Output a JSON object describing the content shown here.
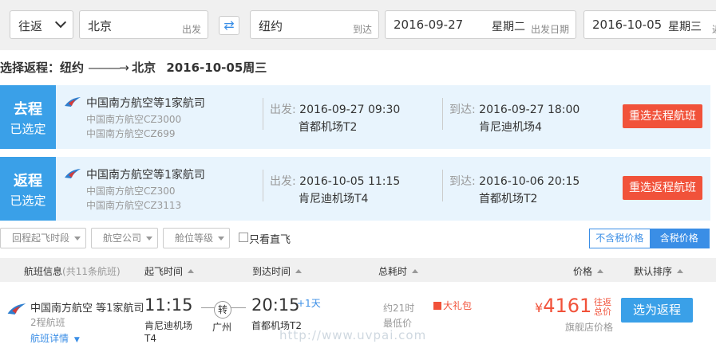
{
  "search": {
    "trip_type": "往返",
    "from_city": "北京",
    "from_label": "出发",
    "to_city": "纽约",
    "to_label": "到达",
    "depart_date": "2016-09-27",
    "depart_weekday": "星期二",
    "depart_label": "出发日期",
    "return_date": "2016-10-05",
    "return_weekday": "星期三",
    "return_label": "返"
  },
  "route_title": {
    "prefix": "选择返程：纽约",
    "arrow": "———→",
    "dest": "北京",
    "date": "2016-10-05周三"
  },
  "selected": [
    {
      "badge_big": "去程",
      "badge_small": "已选定",
      "airline": "中国南方航空等1家航司",
      "flight1": "中国南方航空CZ3000",
      "flight2": "中国南方航空CZ699",
      "dep_label": "出发:",
      "dep_time": "2016-09-27 09:30",
      "dep_airport": "首都机场T2",
      "arr_label": "到达:",
      "arr_time": "2016-09-27 18:00",
      "arr_airport": "肯尼迪机场4",
      "button": "重选去程航班"
    },
    {
      "badge_big": "返程",
      "badge_small": "已选定",
      "airline": "中国南方航空等1家航司",
      "flight1": "中国南方航空CZ300",
      "flight2": "中国南方航空CZ3113",
      "dep_label": "出发:",
      "dep_time": "2016-10-05 11:15",
      "dep_airport": "肯尼迪机场T4",
      "arr_label": "到达:",
      "arr_time": "2016-10-06 20:15",
      "arr_airport": "首都机场T2",
      "button": "重选返程航班"
    }
  ],
  "filters": {
    "return_time": "回程起飞时段",
    "airline": "航空公司",
    "cabin": "舱位等级",
    "direct_only": "只看直飞",
    "tax_exclusive": "不含税价格",
    "tax_inclusive": "含税价格"
  },
  "table_header": {
    "flight_info": "航班信息",
    "flight_count": "(共11条航班)",
    "dep_time": "起飞时间",
    "arr_time": "到达时间",
    "duration": "总耗时",
    "price": "价格",
    "sort": "默认排序"
  },
  "result": {
    "airline": "中国南方航空 等1家航司",
    "legs": "2程航班",
    "detail_link": "航班详情",
    "dep_time": "11:15",
    "dep_airport": "肯尼迪机场",
    "dep_terminal": "T4",
    "transfer_mark": "转",
    "transfer_city": "广州",
    "arr_time": "20:15",
    "plus_day": "+1天",
    "arr_airport": "首都机场T2",
    "duration": "约21时",
    "lowest": "最低价",
    "gift": "大礼包",
    "currency": "¥",
    "price": "4161",
    "tax_note": "往返总价",
    "flagship": "旗舰店价格",
    "choose_button": "选为返程"
  },
  "watermark": "http://www.uvpai.com",
  "colors": {
    "accent_blue": "#3aa0e8",
    "link_blue": "#3a8ee6",
    "price_red": "#f1523a",
    "selected_bg": "#e8f4fd"
  }
}
